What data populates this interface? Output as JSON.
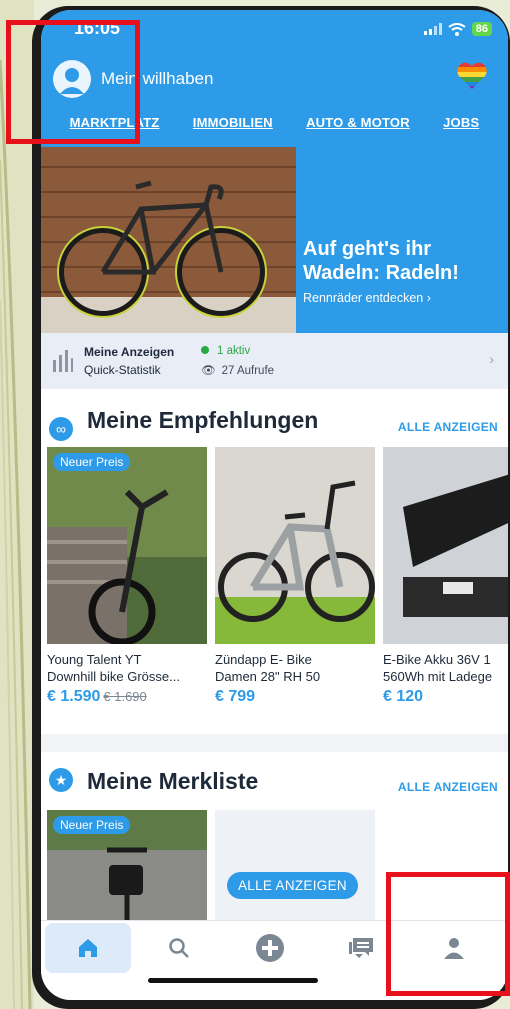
{
  "status_bar": {
    "time": "16:05",
    "battery": "86"
  },
  "header": {
    "brand": "Mein willhaben"
  },
  "categories": [
    "MARKTPLATZ",
    "IMMOBILIEN",
    "AUTO & MOTOR",
    "JOBS"
  ],
  "banner": {
    "title_line1": "Auf geht's ihr",
    "title_line2": "Wadeln: Radeln!",
    "link": "Rennräder entdecken ›"
  },
  "stats": {
    "title": "Meine Anzeigen",
    "subtitle": "Quick-Statistik",
    "active": "1 aktiv",
    "views": "27 Aufrufe"
  },
  "recommendations": {
    "title": "Meine Empfehlungen",
    "link": "ALLE ANZEIGEN",
    "items": [
      {
        "badge": "Neuer Preis",
        "title1": "Young Talent YT",
        "title2": "Downhill bike Grösse...",
        "price": "€ 1.590",
        "old_price": "€ 1.690"
      },
      {
        "title1": "Zündapp E- Bike",
        "title2": "Damen 28\" RH 50",
        "price": "€ 799"
      },
      {
        "title1": "E-Bike Akku 36V 1",
        "title2": "560Wh mit Ladege",
        "price": "€ 120"
      }
    ]
  },
  "watchlist": {
    "title": "Meine Merkliste",
    "link": "ALLE ANZEIGEN",
    "item_badge": "Neuer Preis",
    "all_button": "ALLE ANZEIGEN"
  },
  "tabs": [
    "home-icon",
    "search-icon",
    "add-icon",
    "messages-icon",
    "profile-icon"
  ],
  "colors": {
    "primary": "#2d9be8",
    "annotation": "#e8101a",
    "active_green": "#2aa744"
  }
}
